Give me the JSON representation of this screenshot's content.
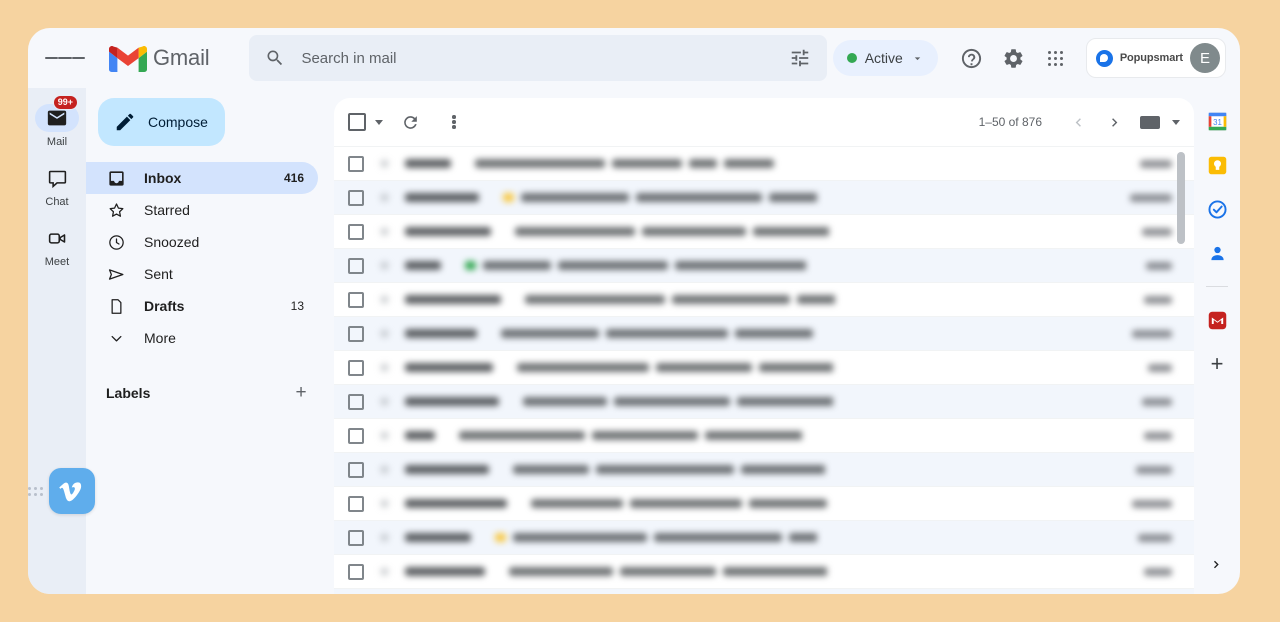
{
  "background_color": "#f6d3a0",
  "header": {
    "menu_icon": "hamburger-menu-icon",
    "logo_icon": "gmail-logo-icon",
    "brand": "Gmail",
    "search": {
      "icon": "search-icon",
      "placeholder": "Search in mail",
      "value": "",
      "filter_icon": "search-options-icon"
    },
    "status": {
      "label": "Active",
      "dot_color": "#34a853",
      "chevron_icon": "chevron-down-icon"
    },
    "help_icon": "help-icon",
    "settings_icon": "gear-icon",
    "apps_icon": "google-apps-grid-icon",
    "account": {
      "brand_name": "Popupsmart",
      "brand_logo_icon": "popupsmart-logo-icon",
      "avatar_initial": "E"
    }
  },
  "rail": {
    "items": [
      {
        "label": "Mail",
        "icon": "mail-icon",
        "badge": "99+",
        "active": true
      },
      {
        "label": "Chat",
        "icon": "chat-bubble-icon",
        "badge": "",
        "active": false
      },
      {
        "label": "Meet",
        "icon": "video-camera-icon",
        "badge": "",
        "active": false
      }
    ]
  },
  "sidebar": {
    "compose": {
      "label": "Compose",
      "icon": "pencil-icon"
    },
    "nav": [
      {
        "label": "Inbox",
        "icon": "inbox-icon",
        "count": "416",
        "active": true,
        "bold": false
      },
      {
        "label": "Starred",
        "icon": "star-icon",
        "count": "",
        "active": false,
        "bold": false
      },
      {
        "label": "Snoozed",
        "icon": "clock-icon",
        "count": "",
        "active": false,
        "bold": false
      },
      {
        "label": "Sent",
        "icon": "send-icon",
        "count": "",
        "active": false,
        "bold": false
      },
      {
        "label": "Drafts",
        "icon": "draft-icon",
        "count": "13",
        "active": false,
        "bold": true
      },
      {
        "label": "More",
        "icon": "chevron-down-icon",
        "count": "",
        "active": false,
        "bold": false
      }
    ],
    "labels": {
      "title": "Labels",
      "add_icon": "plus-icon"
    }
  },
  "toolbar": {
    "select_all_checkbox": "select-all-checkbox",
    "select_dropdown_icon": "chevron-down-icon",
    "refresh_icon": "refresh-icon",
    "more_icon": "kebab-menu-icon",
    "page_range": "1–50 of 876",
    "prev_icon": "chevron-left-icon",
    "next_icon": "chevron-right-icon",
    "input_tools_icon": "keyboard-icon",
    "input_tools_caret_icon": "chevron-down-icon"
  },
  "mail_list": {
    "note": "All message text is blurred/obscured in the screenshot and is not legible.",
    "rows": [
      {
        "alt": false,
        "sender_w": 46,
        "subject_w": 130,
        "subject2_w": 70,
        "subject3_w": 28,
        "subject4_w": 50,
        "date_w": 32,
        "accent": ""
      },
      {
        "alt": true,
        "sender_w": 74,
        "subject_w": 108,
        "subject2_w": 126,
        "subject3_w": 86,
        "subject4_w": 96,
        "date_w": 42,
        "accent": "#f7c948"
      },
      {
        "alt": false,
        "sender_w": 86,
        "subject_w": 120,
        "subject2_w": 104,
        "subject3_w": 116,
        "subject4_w": 62,
        "date_w": 30,
        "accent": ""
      },
      {
        "alt": true,
        "sender_w": 36,
        "subject_w": 68,
        "subject2_w": 110,
        "subject3_w": 140,
        "subject4_w": 110,
        "date_w": 26,
        "accent": "#34a853"
      },
      {
        "alt": false,
        "sender_w": 96,
        "subject_w": 140,
        "subject2_w": 118,
        "subject3_w": 96,
        "subject4_w": 86,
        "date_w": 28,
        "accent": ""
      },
      {
        "alt": true,
        "sender_w": 72,
        "subject_w": 98,
        "subject2_w": 122,
        "subject3_w": 78,
        "subject4_w": 56,
        "date_w": 40,
        "accent": ""
      },
      {
        "alt": false,
        "sender_w": 88,
        "subject_w": 132,
        "subject2_w": 96,
        "subject3_w": 148,
        "subject4_w": 74,
        "date_w": 24,
        "accent": ""
      },
      {
        "alt": true,
        "sender_w": 94,
        "subject_w": 84,
        "subject2_w": 116,
        "subject3_w": 104,
        "subject4_w": 96,
        "date_w": 30,
        "accent": ""
      },
      {
        "alt": false,
        "sender_w": 30,
        "subject_w": 126,
        "subject2_w": 106,
        "subject3_w": 132,
        "subject4_w": 66,
        "date_w": 28,
        "accent": ""
      },
      {
        "alt": true,
        "sender_w": 84,
        "subject_w": 76,
        "subject2_w": 138,
        "subject3_w": 90,
        "subject4_w": 88,
        "date_w": 36,
        "accent": ""
      },
      {
        "alt": false,
        "sender_w": 102,
        "subject_w": 92,
        "subject2_w": 112,
        "subject3_w": 78,
        "subject4_w": 102,
        "date_w": 40,
        "accent": ""
      },
      {
        "alt": true,
        "sender_w": 66,
        "subject_w": 134,
        "subject2_w": 128,
        "subject3_w": 110,
        "subject4_w": 80,
        "date_w": 34,
        "accent": "#f7c948"
      },
      {
        "alt": false,
        "sender_w": 80,
        "subject_w": 104,
        "subject2_w": 96,
        "subject3_w": 124,
        "subject4_w": 72,
        "date_w": 28,
        "accent": ""
      },
      {
        "alt": true,
        "sender_w": 54,
        "subject_w": 118,
        "subject2_w": 142,
        "subject3_w": 88,
        "subject4_w": 60,
        "date_w": 30,
        "accent": ""
      }
    ]
  },
  "side_panel": {
    "items": [
      {
        "name": "google-calendar-icon",
        "label": "31"
      },
      {
        "name": "google-keep-icon",
        "label": ""
      },
      {
        "name": "google-tasks-icon",
        "label": ""
      },
      {
        "name": "google-contacts-icon",
        "label": ""
      },
      {
        "name": "gmail-addon-icon",
        "label": ""
      }
    ],
    "add_icon": "plus-icon",
    "expand_icon": "chevron-right-icon"
  },
  "float_widget": {
    "drag_handle_icon": "drag-handle-dots-icon",
    "logo_icon": "vimeo-logo-icon",
    "color": "#5fadec"
  }
}
